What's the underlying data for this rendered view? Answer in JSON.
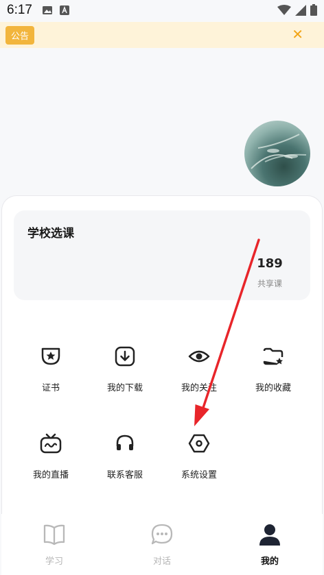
{
  "status_bar": {
    "time": "6:17",
    "icons": [
      "image-icon",
      "a-badge-icon",
      "wifi-icon",
      "signal-icon",
      "battery-icon"
    ]
  },
  "notice": {
    "badge": "公告",
    "close": "✕"
  },
  "profile": {
    "avatar": "avatar-image"
  },
  "course": {
    "title": "学校选课",
    "count": "189",
    "count_label": "共享课"
  },
  "menu": [
    {
      "label": "证书",
      "icon": "certificate-icon"
    },
    {
      "label": "我的下载",
      "icon": "download-icon"
    },
    {
      "label": "我的关注",
      "icon": "eye-icon"
    },
    {
      "label": "我的收藏",
      "icon": "folder-star-icon"
    },
    {
      "label": "我的直播",
      "icon": "tv-icon"
    },
    {
      "label": "联系客服",
      "icon": "headset-icon"
    },
    {
      "label": "系统设置",
      "icon": "settings-hexagon-icon"
    }
  ],
  "bottom_nav": [
    {
      "label": "学习",
      "icon": "book-icon",
      "active": false
    },
    {
      "label": "对话",
      "icon": "chat-icon",
      "active": false
    },
    {
      "label": "我的",
      "icon": "person-icon",
      "active": true
    }
  ],
  "colors": {
    "notice_bg": "#fef3d9",
    "notice_badge": "#f2b53c",
    "notice_close": "#f2a416",
    "arrow": "#e8252a",
    "page_bg": "#f7f8fa"
  }
}
